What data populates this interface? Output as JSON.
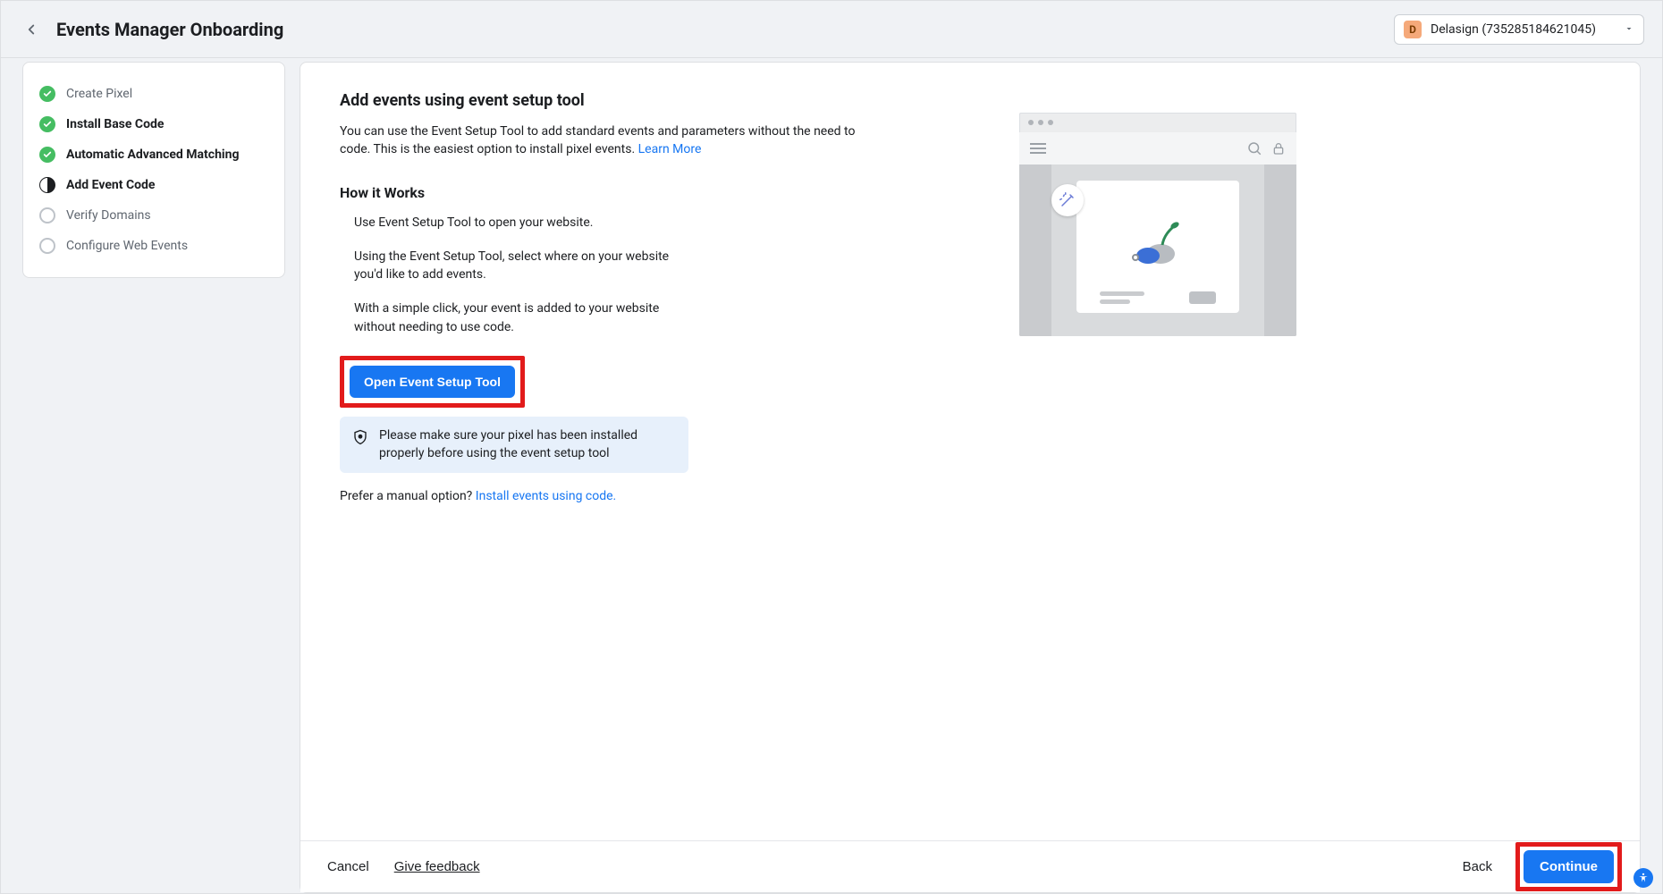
{
  "header": {
    "title": "Events Manager Onboarding",
    "account_badge": "D",
    "account_name": "Delasign (735285184621045)"
  },
  "sidebar": {
    "steps": [
      {
        "label": "Create Pixel",
        "state": "done",
        "bold": false
      },
      {
        "label": "Install Base Code",
        "state": "done",
        "bold": true
      },
      {
        "label": "Automatic Advanced Matching",
        "state": "done",
        "bold": true
      },
      {
        "label": "Add Event Code",
        "state": "current",
        "bold": true
      },
      {
        "label": "Verify Domains",
        "state": "upcoming",
        "bold": false
      },
      {
        "label": "Configure Web Events",
        "state": "upcoming",
        "bold": false
      }
    ]
  },
  "main": {
    "heading": "Add events using event setup tool",
    "lead": "You can use the Event Setup Tool to add standard events and parameters without the need to code. This is the easiest option to install pixel events. ",
    "learn_more": "Learn More",
    "how_heading": "How it Works",
    "bullets": [
      "Use Event Setup Tool to open your website.",
      "Using the Event Setup Tool, select where on your website you'd like to add events.",
      "With a simple click, your event is added to your website without needing to use code."
    ],
    "open_tool_btn": "Open Event Setup Tool",
    "notice": "Please make sure your pixel has been installed properly before using the event setup tool",
    "prefer_prefix": "Prefer a manual option? ",
    "prefer_link": "Install events using code."
  },
  "footer": {
    "cancel": "Cancel",
    "feedback": "Give feedback",
    "back": "Back",
    "continue": "Continue"
  }
}
